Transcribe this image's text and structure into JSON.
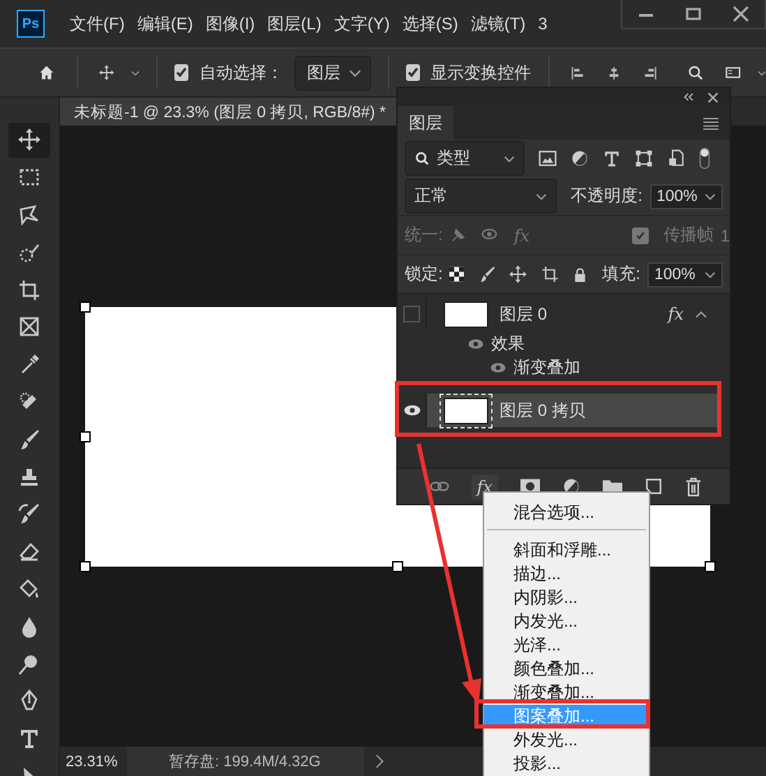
{
  "app": {
    "logo": "Ps"
  },
  "menu": [
    "文件(F)",
    "编辑(E)",
    "图像(I)",
    "图层(L)",
    "文字(Y)",
    "选择(S)",
    "滤镜(T)",
    "3"
  ],
  "options_bar": {
    "auto_select": {
      "label": "自动选择：",
      "checked": true
    },
    "auto_select_target": "图层",
    "show_transform": {
      "label": "显示变换控件",
      "checked": true
    }
  },
  "document_tab": {
    "title": "未标题-1 @ 23.3% (图层 0 拷贝, RGB/8#) *"
  },
  "tools": [
    {
      "kind": "move",
      "selected": true
    },
    {
      "kind": "marquee",
      "selected": false
    },
    {
      "kind": "lasso",
      "selected": false
    },
    {
      "kind": "quick-select",
      "selected": false
    },
    {
      "kind": "crop",
      "selected": false
    },
    {
      "kind": "frame",
      "selected": false
    },
    {
      "kind": "eyedropper",
      "selected": false
    },
    {
      "kind": "bandage",
      "selected": false
    },
    {
      "kind": "brush",
      "selected": false
    },
    {
      "kind": "stamp",
      "selected": false
    },
    {
      "kind": "history-brush",
      "selected": false
    },
    {
      "kind": "eraser",
      "selected": false
    },
    {
      "kind": "bucket",
      "selected": false
    },
    {
      "kind": "drop",
      "selected": false
    },
    {
      "kind": "dodge",
      "selected": false
    },
    {
      "kind": "pen",
      "selected": false
    },
    {
      "kind": "type",
      "selected": false
    },
    {
      "kind": "pointer",
      "selected": false
    }
  ],
  "status_bar": {
    "zoom": "23.31%",
    "scratch": "暂存盘: 199.4M/4.32G"
  },
  "layers_panel": {
    "tab": "图层",
    "filter": "类型",
    "blend_mode": "正常",
    "opacity_label": "不透明度:",
    "opacity": "100%",
    "unify_label": "统一:",
    "unify_fx": "fx",
    "bottom_fx": "fx",
    "propagate": {
      "label": "传播帧",
      "checked": true
    },
    "propagate_count": "1",
    "lock_label": "锁定:",
    "fill_label": "填充:",
    "fill": "100%",
    "layers": [
      {
        "name": "图层 0",
        "visible": false,
        "selected": false,
        "fx_label": "fx",
        "effects_label": "效果",
        "effects": [
          "渐变叠加"
        ]
      },
      {
        "name": "图层 0 拷贝",
        "visible": true,
        "selected": true
      }
    ]
  },
  "fx_menu": {
    "items": [
      {
        "kind": "item",
        "label": "混合选项...",
        "selected": false
      },
      {
        "kind": "separator"
      },
      {
        "kind": "item",
        "label": "斜面和浮雕...",
        "selected": false
      },
      {
        "kind": "item",
        "label": "描边...",
        "selected": false
      },
      {
        "kind": "item",
        "label": "内阴影...",
        "selected": false
      },
      {
        "kind": "item",
        "label": "内发光...",
        "selected": false
      },
      {
        "kind": "item",
        "label": "光泽...",
        "selected": false
      },
      {
        "kind": "item",
        "label": "颜色叠加...",
        "selected": false
      },
      {
        "kind": "item",
        "label": "渐变叠加...",
        "selected": false
      },
      {
        "kind": "item",
        "label": "图案叠加...",
        "selected": true
      },
      {
        "kind": "item",
        "label": "外发光...",
        "selected": false
      },
      {
        "kind": "item",
        "label": "投影...",
        "selected": false
      }
    ]
  }
}
